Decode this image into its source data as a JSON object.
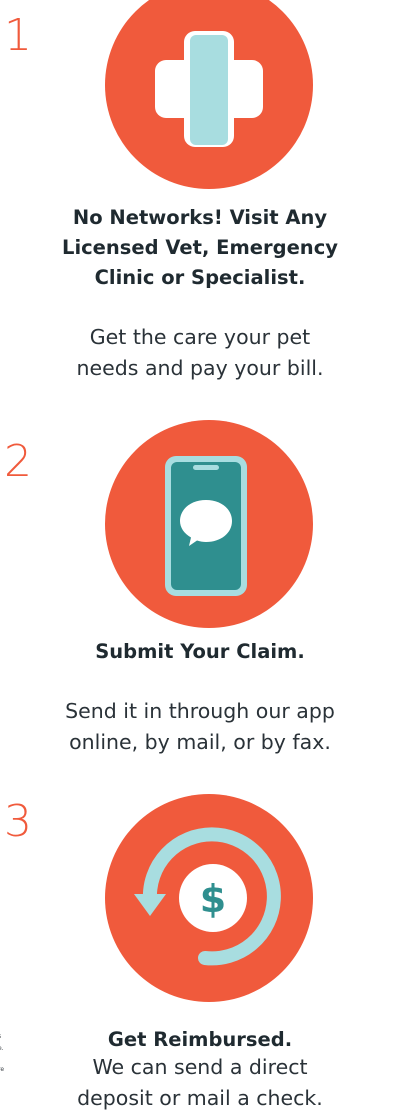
{
  "colors": {
    "accent": "#f05a3c",
    "teal": "#2f8f8f",
    "light_teal": "#a8dde0",
    "text": "#1f2a30"
  },
  "steps": [
    {
      "number": "1",
      "icon": "medical-cross-icon",
      "heading_lines": [
        "No Networks! Visit Any",
        "Licensed Vet, Emergency",
        "Clinic or Specialist."
      ],
      "description_lines": [
        "Get the care your pet",
        "needs and pay your bill."
      ]
    },
    {
      "number": "2",
      "icon": "phone-chat-icon",
      "heading_lines": [
        "Submit Your Claim."
      ],
      "description_lines": [
        "Send it in through our app",
        "online, by mail, or by fax."
      ]
    },
    {
      "number": "3",
      "icon": "dollar-refund-icon",
      "heading_lines": [
        "Get Reimbursed."
      ],
      "description_lines": [
        "We can send a direct",
        "deposit or mail a check."
      ]
    }
  ],
  "icon_glyphs": {
    "dollar": "$"
  },
  "footnote_fragments": [
    "s",
    "e.",
    "re"
  ]
}
